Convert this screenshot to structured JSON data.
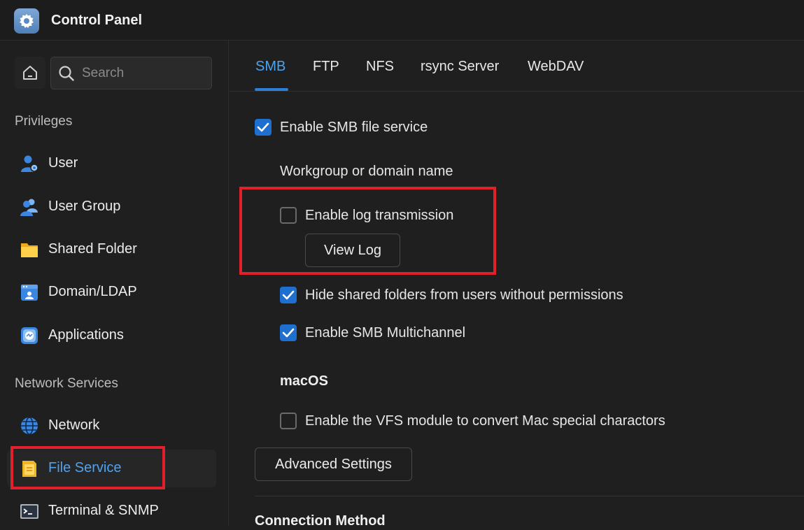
{
  "app": {
    "title": "Control Panel",
    "icon": "gear-icon"
  },
  "search": {
    "placeholder": "Search",
    "value": ""
  },
  "sidebar": {
    "sections": [
      {
        "title": "Privileges",
        "items": [
          {
            "label": "User",
            "icon": "user-icon"
          },
          {
            "label": "User Group",
            "icon": "user-group-icon"
          },
          {
            "label": "Shared Folder",
            "icon": "folder-icon"
          },
          {
            "label": "Domain/LDAP",
            "icon": "domain-icon"
          },
          {
            "label": "Applications",
            "icon": "applications-icon"
          }
        ]
      },
      {
        "title": "Network Services",
        "items": [
          {
            "label": "Network",
            "icon": "globe-icon"
          },
          {
            "label": "File Service",
            "icon": "file-service-icon",
            "active": true
          },
          {
            "label": "Terminal & SNMP",
            "icon": "terminal-icon"
          }
        ]
      }
    ]
  },
  "tabs": [
    {
      "label": "SMB",
      "active": true
    },
    {
      "label": "FTP"
    },
    {
      "label": "NFS"
    },
    {
      "label": "rsync Server"
    },
    {
      "label": "WebDAV"
    }
  ],
  "smb": {
    "enable_service": {
      "label": "Enable SMB file service",
      "checked": true
    },
    "workgroup_label": "Workgroup or domain name",
    "log_transmission": {
      "label": "Enable log transmission",
      "checked": false
    },
    "view_log_button": "View Log",
    "hide_shared": {
      "label": "Hide shared folders from users without permissions",
      "checked": true
    },
    "multichannel": {
      "label": "Enable SMB Multichannel",
      "checked": true
    },
    "macos_heading": "macOS",
    "vfs_module": {
      "label": "Enable the VFS module to convert Mac special charactors",
      "checked": false
    },
    "advanced_button": "Advanced Settings",
    "connection_heading": "Connection Method"
  },
  "colors": {
    "accent": "#4ea3f0",
    "checkbox": "#1f6fd1",
    "highlight_box": "#e0202a",
    "background": "#1f1f1f"
  }
}
